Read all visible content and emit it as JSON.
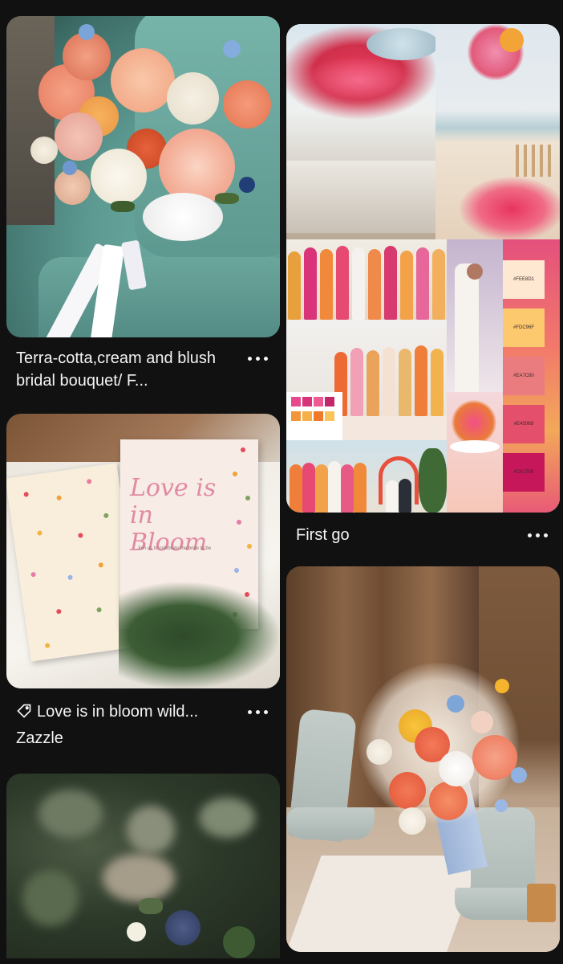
{
  "pins": [
    {
      "id": "pin-1",
      "title": "Terra-cotta,cream and blush bridal bouquet/ F...",
      "image_desc": "bouquet-on-teal-chair"
    },
    {
      "id": "pin-2",
      "title": "Love is in bloom wild...",
      "source": "Zazzle",
      "invitation": {
        "title": "Love is in Bloom",
        "small_text": "Join us to celebrate the bride to be"
      }
    },
    {
      "id": "pin-3",
      "image_desc": "blurred-wildflowers"
    },
    {
      "id": "pin-4",
      "title": "First go",
      "palette": [
        {
          "label": "#FEE8D1",
          "color": "#FEE8D1"
        },
        {
          "label": "#FDC96F",
          "color": "#FDC96F"
        },
        {
          "label": "#EA7C80",
          "color": "#EA7C80"
        },
        {
          "label": "#E4506B",
          "color": "#E4506B"
        },
        {
          "label": "#C6175B",
          "color": "#C6175B"
        }
      ]
    },
    {
      "id": "pin-5",
      "image_desc": "boots-and-bouquet"
    }
  ],
  "colors": {
    "background": "#111111",
    "text": "#F4F4F4"
  }
}
